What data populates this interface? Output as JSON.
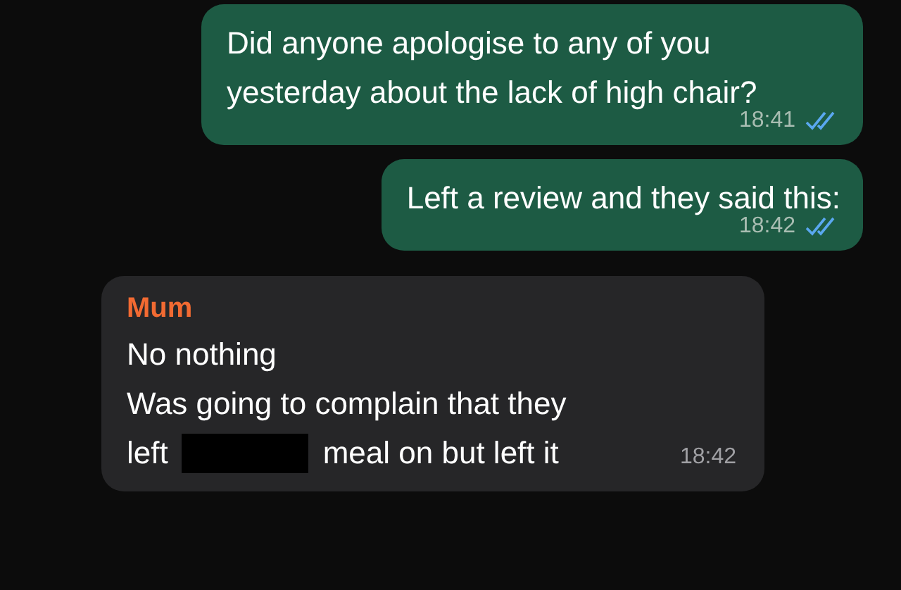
{
  "messages": [
    {
      "kind": "outgoing",
      "text": "Did anyone apologise to any of you yesterday about the lack of high chair?",
      "time": "18:41",
      "read": true
    },
    {
      "kind": "outgoing",
      "text": "Left a review and they said this:",
      "time": "18:42",
      "read": true
    },
    {
      "kind": "incoming",
      "sender": "Mum",
      "lines": [
        "No nothing",
        "Was going to complain that they"
      ],
      "last_line": {
        "before": "left",
        "redacted": true,
        "after": "meal on but left it"
      },
      "time": "18:42"
    }
  ]
}
